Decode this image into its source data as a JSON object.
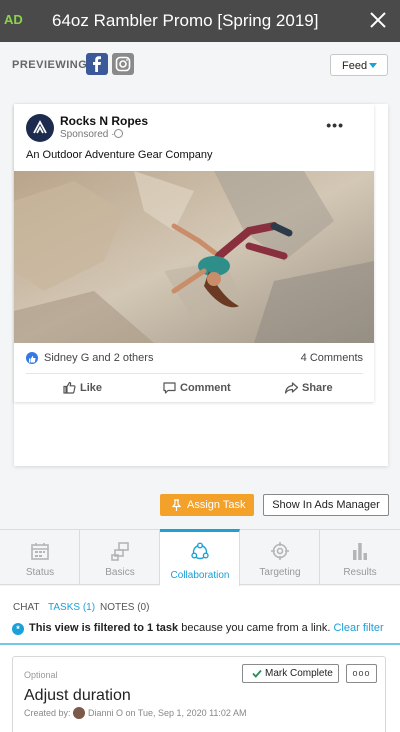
{
  "header": {
    "badge": "AD",
    "title": "64oz Rambler Promo [Spring 2019]"
  },
  "previewing": {
    "label": "PREVIEWING:",
    "placement_select": "Feed"
  },
  "post": {
    "page_name": "Rocks N Ropes",
    "sponsored": "Sponsored ·",
    "text": "An Outdoor Adventure Gear Company",
    "reactions": "Sidney G and 2 others",
    "comments_count": "4 Comments",
    "actions": {
      "like": "Like",
      "comment": "Comment",
      "share": "Share"
    }
  },
  "buttons": {
    "assign_task": "Assign Task",
    "ads_manager": "Show In Ads Manager"
  },
  "tabs": [
    {
      "label": "Status",
      "icon": "calendar-icon"
    },
    {
      "label": "Basics",
      "icon": "basics-icon"
    },
    {
      "label": "Collaboration",
      "icon": "collaboration-icon"
    },
    {
      "label": "Targeting",
      "icon": "target-icon"
    },
    {
      "label": "Results",
      "icon": "bar-chart-icon"
    }
  ],
  "subtabs": {
    "chat": "CHAT",
    "tasks": "TASKS (1)",
    "notes": "NOTES (0)"
  },
  "filter": {
    "prefix": "This view is filtered to 1 task",
    "suffix": " because you came from a link.",
    "clear": "Clear filter"
  },
  "task": {
    "optional": "Optional",
    "mark_complete": "Mark Complete",
    "more": "ooo",
    "title": "Adjust duration",
    "created_by": "Created by:",
    "created_info": "Dianni O on Tue, Sep 1, 2020 11:02 AM"
  },
  "colors": {
    "accent": "#1ba0d8",
    "assign": "#f3a129",
    "header_bg": "#4a4a4a",
    "badge": "#8bd34a"
  }
}
